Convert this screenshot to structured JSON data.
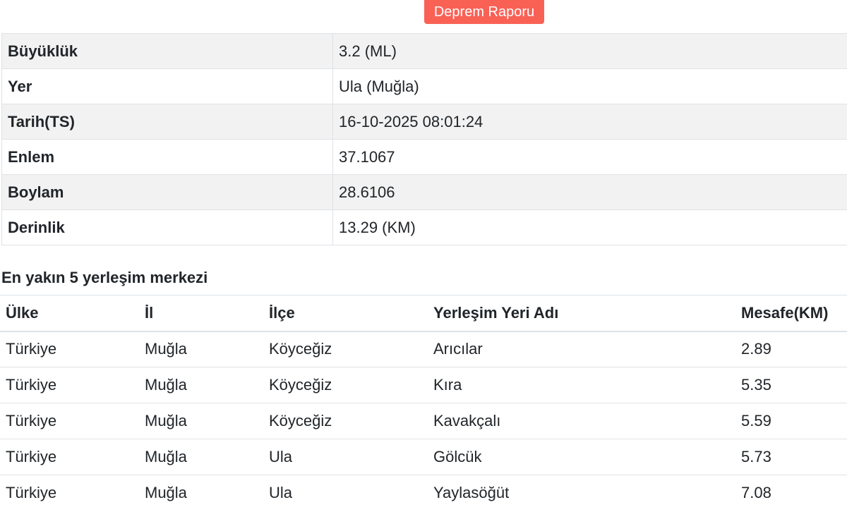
{
  "header": {
    "report_button": "Deprem Raporu"
  },
  "details": [
    {
      "label": "Büyüklük",
      "value": "3.2 (ML)"
    },
    {
      "label": "Yer",
      "value": "Ula (Muğla)"
    },
    {
      "label": "Tarih(TS)",
      "value": "16-10-2025 08:01:24"
    },
    {
      "label": "Enlem",
      "value": "37.1067"
    },
    {
      "label": "Boylam",
      "value": "28.6106"
    },
    {
      "label": "Derinlik",
      "value": "13.29 (KM)"
    }
  ],
  "nearest": {
    "title": "En yakın 5 yerleşim merkezi",
    "columns": [
      "Ülke",
      "İl",
      "İlçe",
      "Yerleşim Yeri Adı",
      "Mesafe(KM)"
    ],
    "rows": [
      [
        "Türkiye",
        "Muğla",
        "Köyceğiz",
        "Arıcılar",
        "2.89"
      ],
      [
        "Türkiye",
        "Muğla",
        "Köyceğiz",
        "Kıra",
        "5.35"
      ],
      [
        "Türkiye",
        "Muğla",
        "Köyceğiz",
        "Kavakçalı",
        "5.59"
      ],
      [
        "Türkiye",
        "Muğla",
        "Ula",
        "Gölcük",
        "5.73"
      ],
      [
        "Türkiye",
        "Muğla",
        "Ula",
        "Yaylasöğüt",
        "7.08"
      ]
    ]
  },
  "colors": {
    "button_bg": "#fa6155",
    "row_stripe": "#f2f2f2",
    "border": "#dee2e6"
  }
}
